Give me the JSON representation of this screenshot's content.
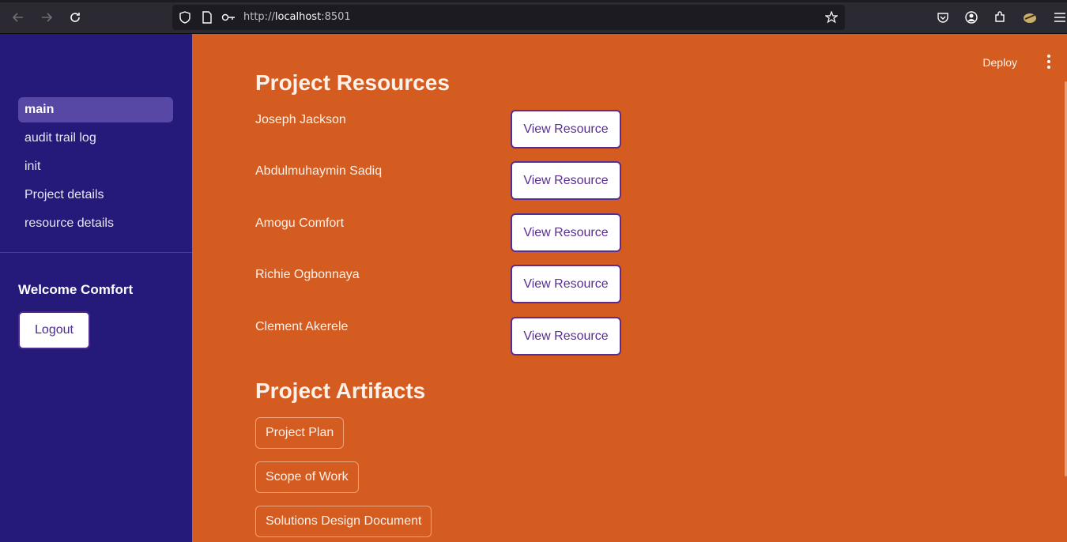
{
  "browser": {
    "url_scheme": "http://",
    "url_host": "localhost",
    "url_port": ":8501"
  },
  "sidebar": {
    "items": [
      {
        "label": "main",
        "active": true
      },
      {
        "label": "audit trail log",
        "active": false
      },
      {
        "label": "init",
        "active": false
      },
      {
        "label": "Project details",
        "active": false
      },
      {
        "label": "resource details",
        "active": false
      }
    ],
    "welcome": "Welcome Comfort",
    "logout_label": "Logout"
  },
  "header": {
    "deploy_label": "Deploy"
  },
  "resources": {
    "title": "Project Resources",
    "button_label": "View Resource",
    "people": [
      "Joseph Jackson",
      "Abdulmuhaymin Sadiq",
      "Amogu Comfort",
      "Richie Ogbonnaya",
      "Clement Akerele"
    ]
  },
  "artifacts": {
    "title": "Project Artifacts",
    "items": [
      "Project Plan",
      "Scope of Work",
      "Solutions Design Document"
    ]
  },
  "colors": {
    "sidebar_bg": "#251a7a",
    "main_bg": "#d45c20",
    "button_accent": "#5a2d91"
  }
}
